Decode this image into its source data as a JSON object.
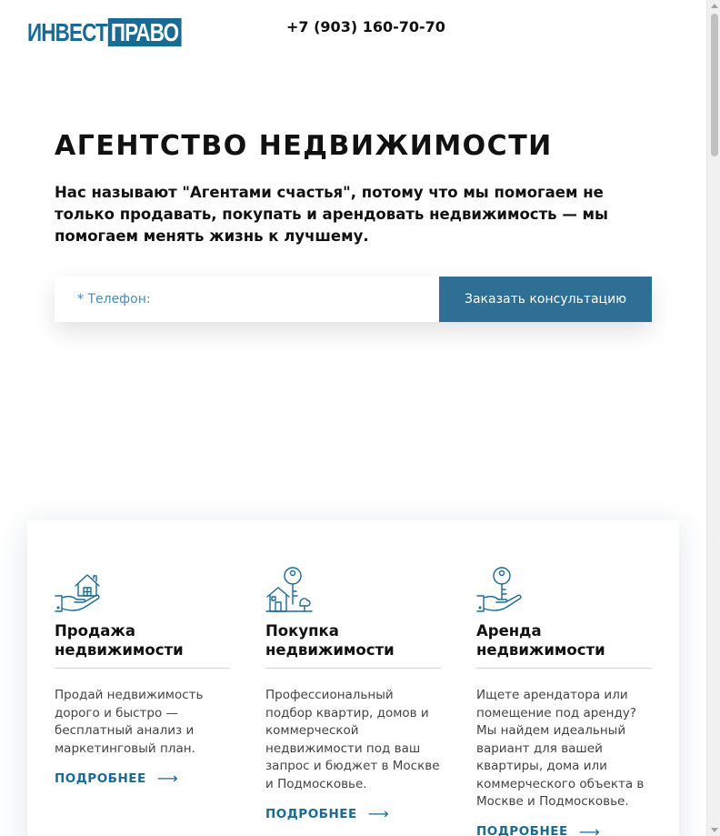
{
  "header": {
    "logo_part1": "ИНВЕСТ",
    "logo_part2": "ПРАВО",
    "phone": "+7 (903) 160-70-70"
  },
  "hero": {
    "title": "АГЕНТСТВО НЕДВИЖИМОСТИ",
    "text": "Нас называют \"Агентами счастья\", потому что мы помогаем не только продавать, покупать и арендовать недвижимость — мы помогаем менять жизнь к лучшему.",
    "phone_placeholder": "* Телефон:",
    "submit_label": "Заказать консультацию"
  },
  "services": [
    {
      "icon": "house-in-hand-icon",
      "title": "Продажа недвижимости",
      "text": "Продай недвижимость дорого и быстро — бесплатный анализ и маркетинговый план.",
      "more_label": "ПОДРОБНЕЕ",
      "arrow": "⟶"
    },
    {
      "icon": "house-with-key-icon",
      "title": "Покупка недвижимости",
      "text": "Профессиональный подбор квартир, домов и коммерческой недвижимости под ваш запрос и бюджет в Москве и Подмосковье.",
      "more_label": "ПОДРОБНЕЕ",
      "arrow": "⟶"
    },
    {
      "icon": "key-in-hand-icon",
      "title": "Аренда недвижимости",
      "text": "Ищете арендатора или помещение под аренду? Мы найдем идеальный вариант для вашей квартиры, дома или коммерческого объекта в Москве и Подмосковье.",
      "more_label": "ПОДРОБНЕЕ",
      "arrow": "⟶"
    }
  ],
  "colors": {
    "brand": "#1a6b93",
    "button": "#2f6f96"
  }
}
